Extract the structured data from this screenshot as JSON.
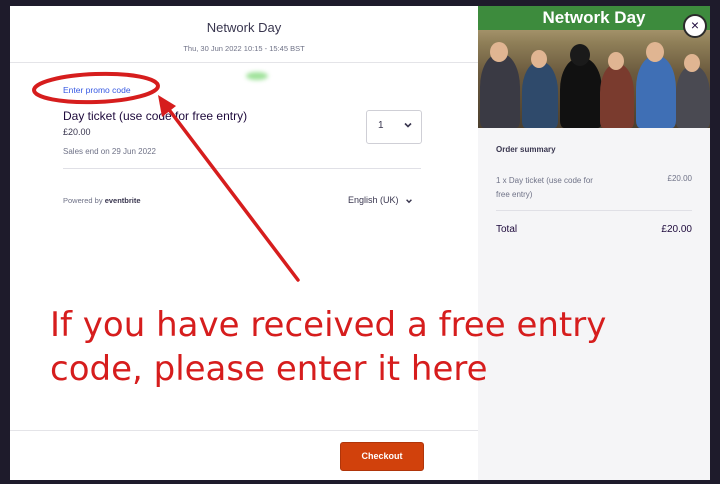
{
  "header": {
    "event_title": "Network Day",
    "event_date": "Thu, 30 Jun 2022 10:15 - 15:45 BST"
  },
  "promo": {
    "link_label": "Enter promo code"
  },
  "ticket": {
    "name": "Day ticket (use code for free entry)",
    "price": "£20.00",
    "sales_end": "Sales end on 29 Jun 2022",
    "quantity": "1"
  },
  "footer": {
    "powered_by_prefix": "Powered by",
    "powered_by_brand": "eventbrite",
    "language": "English (UK)",
    "checkout_label": "Checkout"
  },
  "event_image": {
    "banner_text": "Network Day",
    "close_label": "×"
  },
  "order_summary": {
    "title": "Order summary",
    "item_label": "1 x Day ticket (use code for free entry)",
    "item_price": "£20.00",
    "total_label": "Total",
    "total_value": "£20.00"
  },
  "annotation": {
    "text": "If you have received a free entry code, please enter it here",
    "color": "#d61d1d"
  },
  "colors": {
    "brand_checkout": "#d1410c",
    "link": "#3659e3",
    "banner_green": "#3d8b3d"
  }
}
